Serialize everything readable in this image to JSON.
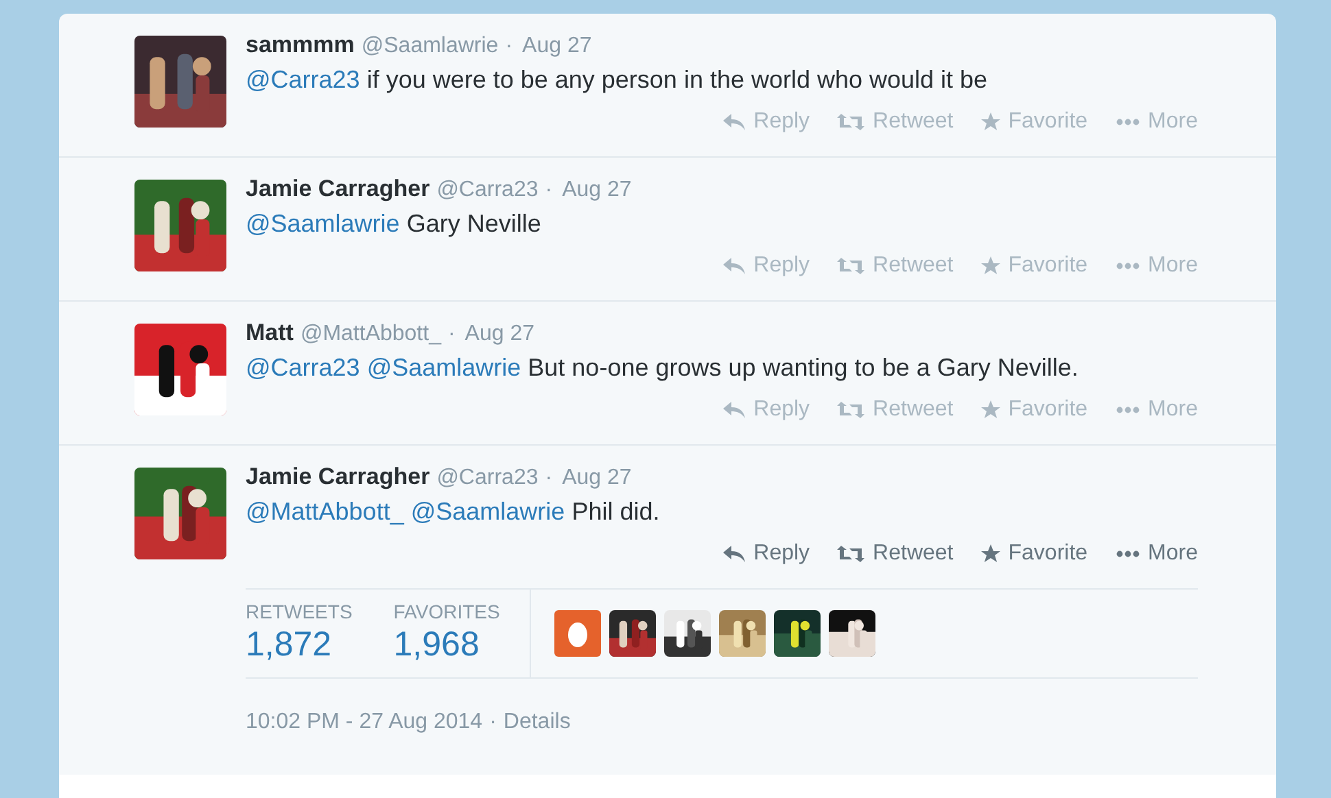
{
  "tweets": [
    {
      "name": "sammmm",
      "handle": "@Saamlawrie",
      "separator": "·",
      "time": "Aug 27",
      "text": [
        {
          "kind": "mention",
          "text": "@Carra23"
        },
        {
          "kind": "plain",
          "text": " if you were to be any person in the world who would it be"
        }
      ],
      "expanded": false,
      "actions": [
        "Reply",
        "Retweet",
        "Favorite",
        "More"
      ]
    },
    {
      "name": "Jamie Carragher",
      "handle": "@Carra23",
      "separator": "·",
      "time": "Aug 27",
      "text": [
        {
          "kind": "mention",
          "text": "@Saamlawrie"
        },
        {
          "kind": "plain",
          "text": " Gary Neville"
        }
      ],
      "expanded": false,
      "actions": [
        "Reply",
        "Retweet",
        "Favorite",
        "More"
      ]
    },
    {
      "name": "Matt",
      "handle": "@MattAbbott_",
      "separator": "·",
      "time": "Aug 27",
      "text": [
        {
          "kind": "mention",
          "text": "@Carra23"
        },
        {
          "kind": "mention",
          "text": "@Saamlawrie"
        },
        {
          "kind": "plain",
          "text": " But no-one grows up wanting to be a Gary Neville."
        }
      ],
      "expanded": false,
      "actions": [
        "Reply",
        "Retweet",
        "Favorite",
        "More"
      ]
    },
    {
      "name": "Jamie Carragher",
      "handle": "@Carra23",
      "separator": "·",
      "time": "Aug 27",
      "text": [
        {
          "kind": "mention",
          "text": "@MattAbbott_"
        },
        {
          "kind": "mention",
          "text": "@Saamlawrie"
        },
        {
          "kind": "plain",
          "text": " Phil did."
        }
      ],
      "expanded": true,
      "actions": [
        "Reply",
        "Retweet",
        "Favorite",
        "More"
      ]
    }
  ],
  "stats": [
    {
      "label": "RETWEETS",
      "value": "1,872"
    },
    {
      "label": "FAVORITES",
      "value": "1,968"
    }
  ],
  "favoriter_avatars": [
    {
      "kind": "egg"
    },
    {
      "kind": "picture"
    },
    {
      "kind": "picture"
    },
    {
      "kind": "picture"
    },
    {
      "kind": "picture"
    },
    {
      "kind": "picture"
    }
  ],
  "timestamp": "10:02 PM - 27 Aug 2014",
  "footer_separator": "·",
  "details_link": "Details"
}
